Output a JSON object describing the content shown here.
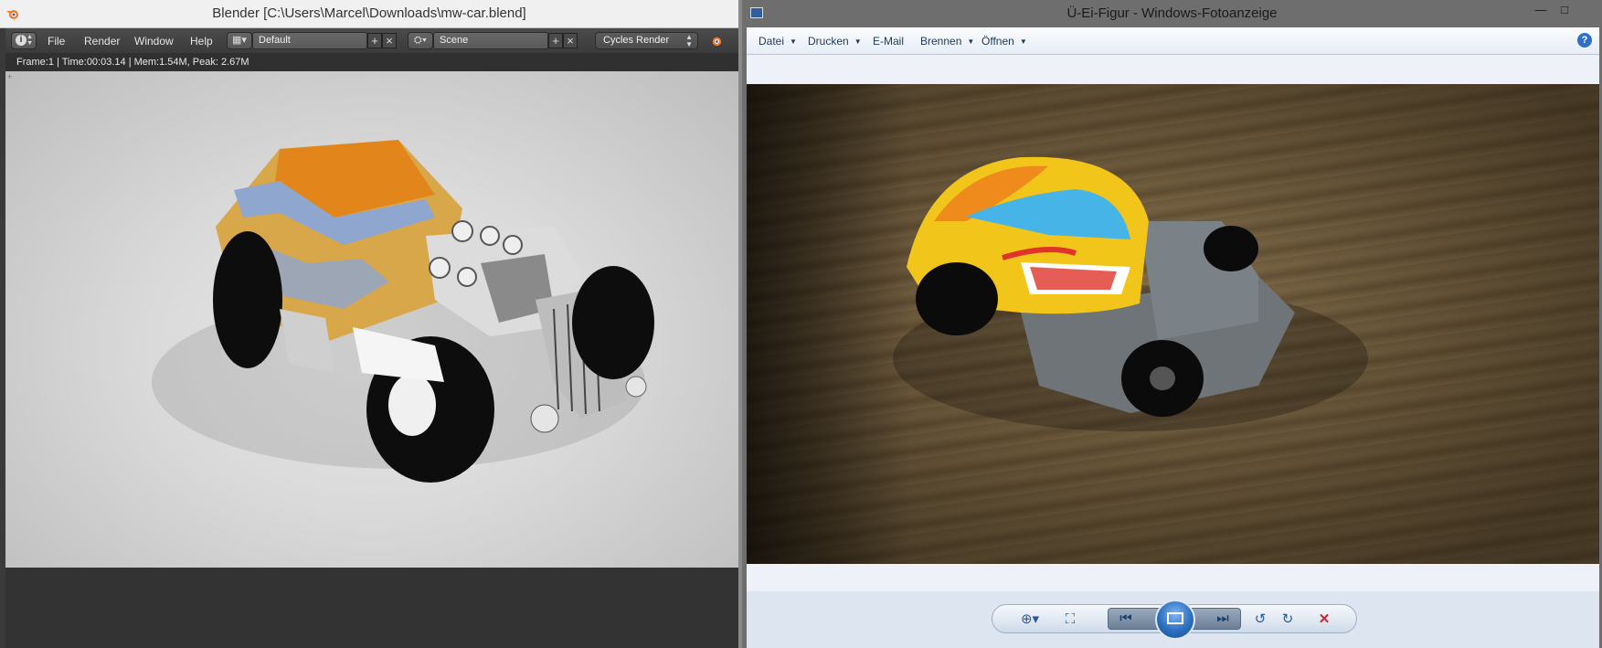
{
  "blender": {
    "title": "Blender [C:\\Users\\Marcel\\Downloads\\mw-car.blend]",
    "menu": [
      "File",
      "Render",
      "Window",
      "Help"
    ],
    "screen_layout": "Default",
    "scene": "Scene",
    "render_engine": "Cycles Render",
    "info": "Frame:1 | Time:00:03.14 | Mem:1.54M, Peak: 2.67M"
  },
  "viewer": {
    "title": "Ü-Ei-Figur - Windows-Fotoanzeige",
    "menu": [
      {
        "label": "Datei",
        "dropdown": true
      },
      {
        "label": "Drucken",
        "dropdown": true
      },
      {
        "label": "E-Mail",
        "dropdown": false
      },
      {
        "label": "Brennen",
        "dropdown": true
      },
      {
        "label": "Öffnen",
        "dropdown": true
      }
    ],
    "help_label": "?",
    "controls": [
      "zoom-icon",
      "fit-window-icon",
      "previous-icon",
      "slideshow-icon",
      "next-icon",
      "rotate-left-icon",
      "rotate-right-icon",
      "delete-icon"
    ]
  },
  "colors": {
    "blender_header": "#454545",
    "viewer_chrome": "#6e6e6e",
    "viewer_accent": "#2f6fc6",
    "delete_red": "#c4282d"
  }
}
